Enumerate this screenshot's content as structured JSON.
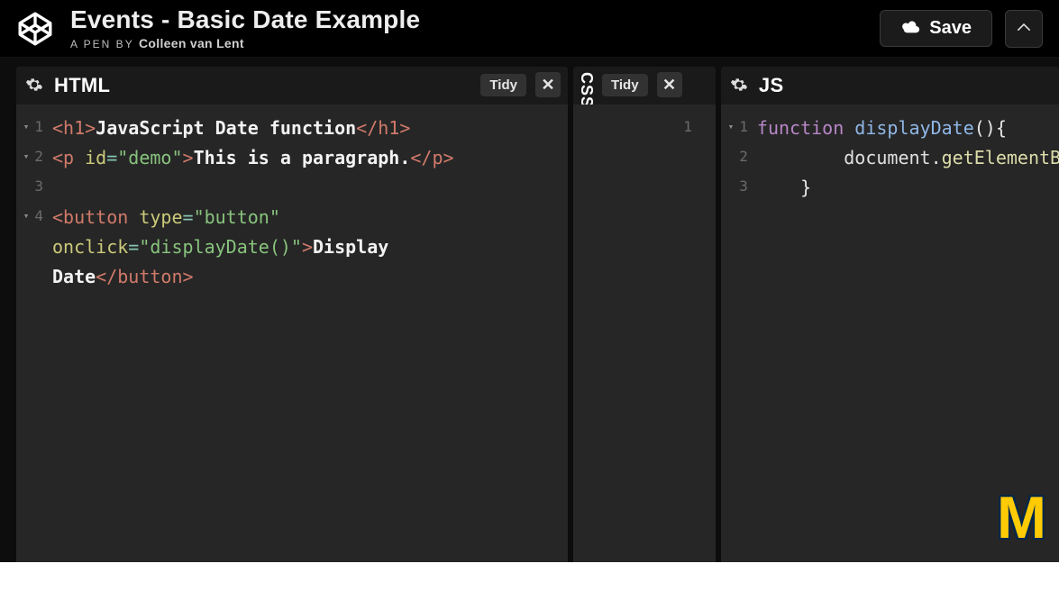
{
  "header": {
    "title": "Events - Basic Date Example",
    "byline_label": "A PEN BY",
    "author": "Colleen van Lent",
    "save_label": "Save"
  },
  "panes": {
    "html": {
      "name": "HTML",
      "tidy_label": "Tidy",
      "lines": [
        "1",
        "2",
        "3",
        "4"
      ]
    },
    "css": {
      "name": "CSS",
      "tidy_label": "Tidy",
      "lines": [
        "1"
      ]
    },
    "js": {
      "name": "JS",
      "lines": [
        "1",
        "2",
        "3"
      ]
    }
  },
  "html_code": {
    "l1": {
      "open": "<h1>",
      "text": "JavaScript Date function",
      "close": "</h1>"
    },
    "l2": {
      "open_tag": "<p",
      "attr_id": " id",
      "eq": "=",
      "val": "\"demo\"",
      "gt": ">",
      "text": "This is a paragraph.",
      "close": "</p>"
    },
    "l4a": {
      "open_tag": "<button",
      "attr_type": " type",
      "eq": "=",
      "val_type": "\"button\""
    },
    "l4b": {
      "attr_onclick": "onclick",
      "eq": "=",
      "val_onclick": "\"displayDate()\"",
      "gt": ">",
      "text1": "Display"
    },
    "l4c": {
      "text2": "Date",
      "close": "</button>"
    }
  },
  "js_code": {
    "l1": {
      "kw": "function",
      "fn": " displayDate",
      "paren": "()",
      "brace": "{"
    },
    "l2": {
      "indent": "        ",
      "obj": "document",
      "dot": ".",
      "method_partial": "getElementB"
    },
    "l3": {
      "indent": "    ",
      "brace": "}"
    }
  },
  "branding": {
    "m": "M"
  }
}
